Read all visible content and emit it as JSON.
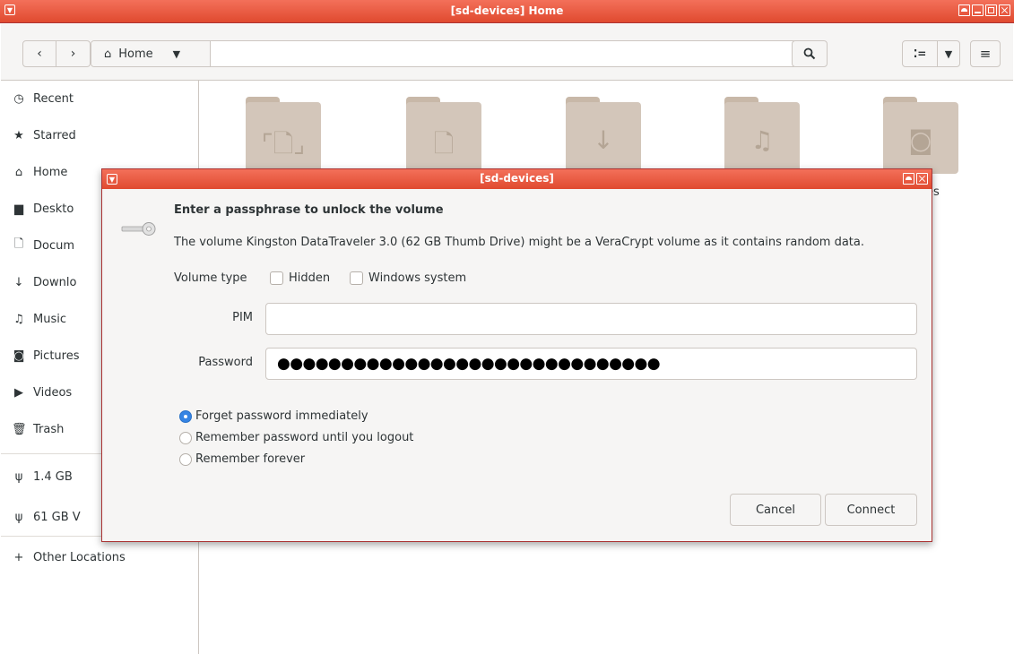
{
  "window": {
    "title": "[sd-devices] Home"
  },
  "toolbar": {
    "back_icon": "chevron-left-icon",
    "forward_icon": "chevron-right-icon",
    "path_label": "Home",
    "search_icon": "search-icon",
    "view_icon": "list-view-icon",
    "menu_icon": "hamburger-menu-icon"
  },
  "sidebar": {
    "items": [
      {
        "label": "Recent",
        "icon": "clock-icon"
      },
      {
        "label": "Starred",
        "icon": "star-icon"
      },
      {
        "label": "Home",
        "icon": "home-icon"
      },
      {
        "label": "Deskto",
        "icon": "desktop-folder-icon"
      },
      {
        "label": "Docum",
        "icon": "document-icon"
      },
      {
        "label": "Downlo",
        "icon": "download-icon"
      },
      {
        "label": "Music",
        "icon": "music-icon"
      },
      {
        "label": "Pictures",
        "icon": "camera-icon"
      },
      {
        "label": "Videos",
        "icon": "video-icon"
      },
      {
        "label": "Trash",
        "icon": "trash-icon"
      }
    ],
    "devices": [
      {
        "label": "1.4 GB",
        "icon": "usb-icon"
      },
      {
        "label": "61 GB V",
        "icon": "usb-icon"
      }
    ],
    "other": {
      "label": "Other Locations",
      "icon": "plus-icon"
    }
  },
  "folders": [
    {
      "icon": "desktop-icon"
    },
    {
      "icon": "document-icon"
    },
    {
      "icon": "download-icon"
    },
    {
      "icon": "music-icon"
    },
    {
      "icon": "camera-icon"
    }
  ],
  "folder_label_fragment": "es",
  "dialog": {
    "title": "[sd-devices]",
    "heading": "Enter a passphrase to unlock the volume",
    "description": "The volume Kingston DataTraveler 3.0 (62 GB Thumb Drive) might be a VeraCrypt volume as it contains random data.",
    "volume_type_label": "Volume type",
    "hidden_label": "Hidden",
    "windows_system_label": "Windows system",
    "pim_label": "PIM",
    "pim_value": "",
    "password_label": "Password",
    "password_value": "●●●●●●●●●●●●●●●●●●●●●●●●●●●●●●",
    "radio_options": [
      {
        "label": "Forget password immediately",
        "selected": true
      },
      {
        "label": "Remember password until you logout",
        "selected": false
      },
      {
        "label": "Remember forever",
        "selected": false
      }
    ],
    "cancel_label": "Cancel",
    "connect_label": "Connect"
  },
  "colors": {
    "titlebar": "#e9573f",
    "accent": "#3584e4",
    "folder": "#d3c6ba"
  }
}
